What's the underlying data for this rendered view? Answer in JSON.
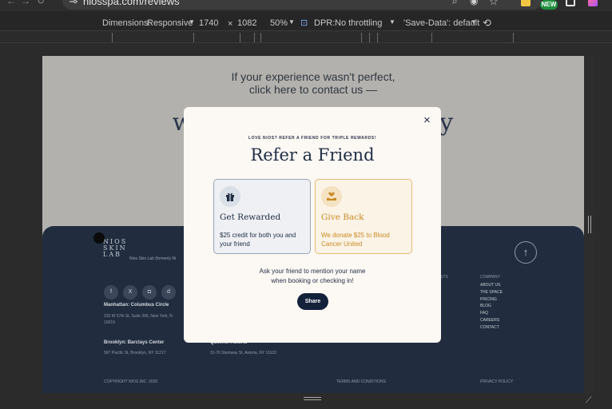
{
  "browser": {
    "url": "niosspa.com/reviews",
    "new_badge": "NEW"
  },
  "device_toolbar": {
    "dimensions_label": "Dimensions:",
    "mode": "Responsive",
    "width": "1740",
    "times": "×",
    "height": "1082",
    "zoom": "50%",
    "dpr_label": "DPR:",
    "throttling": "No throttling",
    "save_data": "'Save-Data': default"
  },
  "page": {
    "contact_line1": "If your experience wasn't perfect,",
    "contact_line2": "click here to contact us —",
    "heading_left": "we",
    "heading_right": "ty"
  },
  "footer": {
    "logo_line1": "NIOS",
    "logo_line2": "SKIN",
    "logo_line3": "LAB",
    "logo_sub": "Nios Skin Lab (formerly Ni",
    "social": [
      "f",
      "X",
      "◘",
      "d"
    ],
    "manhattan_label": "Manhattan:",
    "manhattan_place": "Columbus Circle",
    "manhattan_addr1": "315 W 57th St, Suite 306, New York, N",
    "manhattan_addr2": "10019",
    "brooklyn_label": "Brooklyn:",
    "brooklyn_place": "Barclays Center",
    "brooklyn_addr": "567 Pacific St, Brooklyn, NY 11217",
    "queens_label": "Queens:",
    "queens_place": "Astoria",
    "queens_addr": "31-76 Steinway St, Astoria, NY 11103",
    "partial_col": "STS",
    "company_title": "COMPANY",
    "company_links": [
      "ABOUT US",
      "THE SPACE",
      "PRICING",
      "BLOG",
      "FAQ",
      "CAREERS",
      "CONTACT"
    ],
    "copyright": "COPYRIGHT NIOS INC. 2026",
    "terms": "TERMS AND CONDITIONS",
    "privacy": "PRIVACY POLICY"
  },
  "modal": {
    "close": "×",
    "eyebrow": "LOVE NIOS? REFER A FRIEND FOR TRIPLE REWARDS!",
    "title": "Refer a Friend",
    "card1_title": "Get Rewarded",
    "card1_body": "$25 credit for both you and your friend",
    "card2_title": "Give Back",
    "card2_body": "We donate $25 to Blood Cancer United",
    "desc_line1": "Ask your friend to mention your name",
    "desc_line2": "when booking or checking in!",
    "share": "Share"
  },
  "colors": {
    "modal_bg": "#fcf8f4",
    "navy": "#1f2d44",
    "gold": "#d19a3a",
    "footer_bg": "#212d3f"
  },
  "icons": {
    "card1": "gift-icon",
    "card2": "heart-hand-icon"
  }
}
